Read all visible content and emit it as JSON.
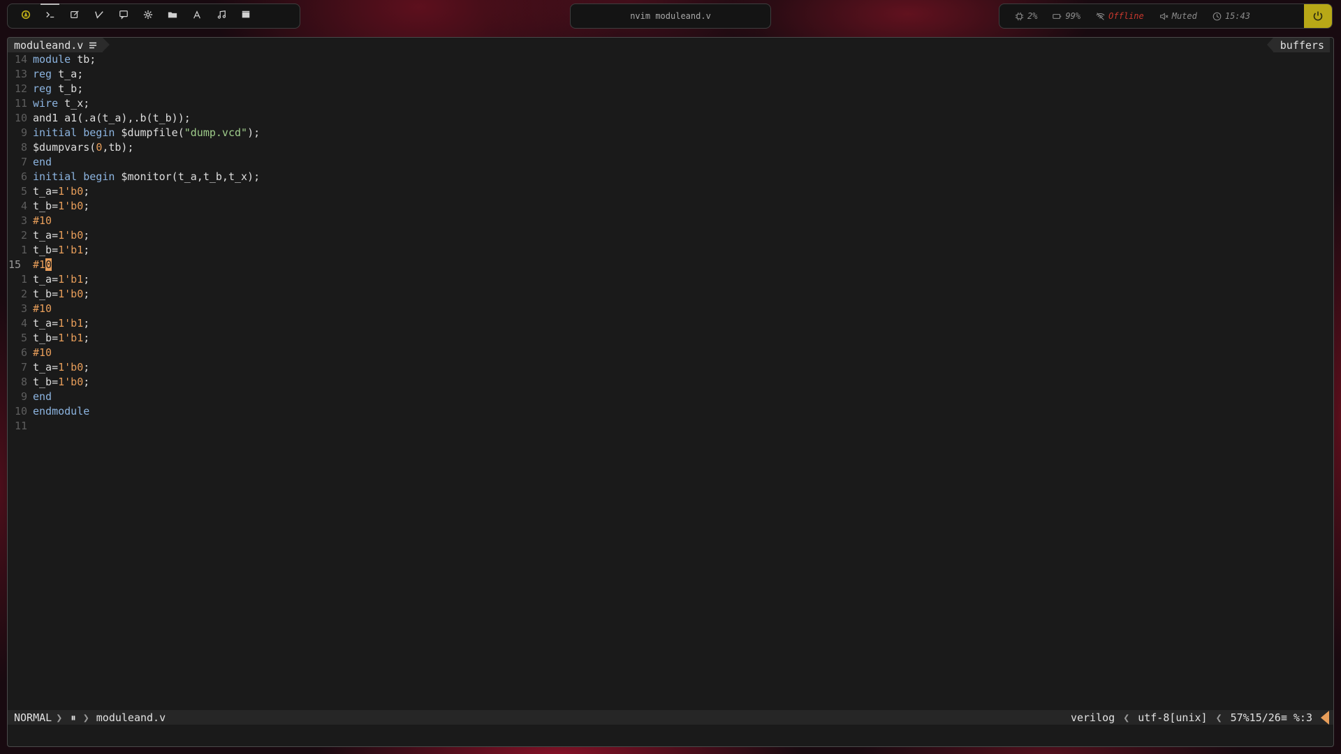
{
  "topbar": {
    "workspaces": [
      {
        "name": "arch-icon",
        "color": "#b8a817"
      },
      {
        "name": "terminal-icon",
        "color": "#d0d0d0"
      },
      {
        "name": "editor-icon",
        "color": "#d0d0d0"
      },
      {
        "name": "code-icon",
        "color": "#d0d0d0"
      },
      {
        "name": "chat-icon",
        "color": "#d0d0d0"
      },
      {
        "name": "settings-icon",
        "color": "#d0d0d0"
      },
      {
        "name": "folder-icon",
        "color": "#d0d0d0"
      },
      {
        "name": "font-icon",
        "color": "#d0d0d0"
      },
      {
        "name": "music-icon",
        "color": "#d0d0d0"
      },
      {
        "name": "video-icon",
        "color": "#d0d0d0"
      }
    ],
    "window_title": "nvim moduleand.v",
    "modules": {
      "cpu": "2%",
      "battery": "99%",
      "network": "Offline",
      "volume": "Muted",
      "clock": "15:43"
    },
    "power_color": "#b8a817"
  },
  "editor": {
    "tab_label": "moduleand.v",
    "buffers_label": "buffers",
    "lines": [
      {
        "n": "14",
        "parts": [
          [
            "kw",
            "module"
          ],
          [
            "txt",
            " tb;"
          ]
        ]
      },
      {
        "n": "13",
        "parts": [
          [
            "kw",
            "reg"
          ],
          [
            "txt",
            " t_a;"
          ]
        ]
      },
      {
        "n": "12",
        "parts": [
          [
            "kw",
            "reg"
          ],
          [
            "txt",
            " t_b;"
          ]
        ]
      },
      {
        "n": "11",
        "parts": [
          [
            "kw",
            "wire"
          ],
          [
            "txt",
            " t_x;"
          ]
        ]
      },
      {
        "n": "10",
        "parts": [
          [
            "txt",
            "and1 a1(.a(t_a),.b(t_b));"
          ]
        ]
      },
      {
        "n": "9",
        "parts": [
          [
            "kw",
            "initial"
          ],
          [
            "txt",
            " "
          ],
          [
            "kw",
            "begin"
          ],
          [
            "txt",
            " $dumpfile("
          ],
          [
            "str",
            "\"dump.vcd\""
          ],
          [
            "txt",
            ");"
          ]
        ]
      },
      {
        "n": "8",
        "parts": [
          [
            "txt",
            "$dumpvars("
          ],
          [
            "num",
            "0"
          ],
          [
            "txt",
            ",tb);"
          ]
        ]
      },
      {
        "n": "7",
        "parts": [
          [
            "kw",
            "end"
          ]
        ]
      },
      {
        "n": "6",
        "parts": [
          [
            "kw",
            "initial"
          ],
          [
            "txt",
            " "
          ],
          [
            "kw",
            "begin"
          ],
          [
            "txt",
            " $monitor(t_a,t_b,t_x);"
          ]
        ]
      },
      {
        "n": "5",
        "parts": [
          [
            "txt",
            "t_a="
          ],
          [
            "num",
            "1'b0"
          ],
          [
            "txt",
            ";"
          ]
        ]
      },
      {
        "n": "4",
        "parts": [
          [
            "txt",
            "t_b="
          ],
          [
            "num",
            "1'b0"
          ],
          [
            "txt",
            ";"
          ]
        ]
      },
      {
        "n": "3",
        "parts": [
          [
            "num",
            "#10"
          ]
        ]
      },
      {
        "n": "2",
        "parts": [
          [
            "txt",
            "t_a="
          ],
          [
            "num",
            "1'b0"
          ],
          [
            "txt",
            ";"
          ]
        ]
      },
      {
        "n": "1",
        "parts": [
          [
            "txt",
            "t_b="
          ],
          [
            "num",
            "1'b1"
          ],
          [
            "txt",
            ";"
          ]
        ]
      },
      {
        "n": "15",
        "current": true,
        "parts": [
          [
            "num",
            "#1"
          ],
          [
            "cursor",
            "0"
          ]
        ]
      },
      {
        "n": "1",
        "parts": [
          [
            "txt",
            "t_a="
          ],
          [
            "num",
            "1'b1"
          ],
          [
            "txt",
            ";"
          ]
        ]
      },
      {
        "n": "2",
        "parts": [
          [
            "txt",
            "t_b="
          ],
          [
            "num",
            "1'b0"
          ],
          [
            "txt",
            ";"
          ]
        ]
      },
      {
        "n": "3",
        "parts": [
          [
            "num",
            "#10"
          ]
        ]
      },
      {
        "n": "4",
        "parts": [
          [
            "txt",
            "t_a="
          ],
          [
            "num",
            "1'b1"
          ],
          [
            "txt",
            ";"
          ]
        ]
      },
      {
        "n": "5",
        "parts": [
          [
            "txt",
            "t_b="
          ],
          [
            "num",
            "1'b1"
          ],
          [
            "txt",
            ";"
          ]
        ]
      },
      {
        "n": "6",
        "parts": [
          [
            "num",
            "#10"
          ]
        ]
      },
      {
        "n": "7",
        "parts": [
          [
            "txt",
            "t_a="
          ],
          [
            "num",
            "1'b0"
          ],
          [
            "txt",
            ";"
          ]
        ]
      },
      {
        "n": "8",
        "parts": [
          [
            "txt",
            "t_b="
          ],
          [
            "num",
            "1'b0"
          ],
          [
            "txt",
            ";"
          ]
        ]
      },
      {
        "n": "9",
        "parts": [
          [
            "kw",
            "end"
          ]
        ]
      },
      {
        "n": "10",
        "parts": [
          [
            "kw",
            "endmodule"
          ]
        ]
      },
      {
        "n": "11",
        "parts": []
      }
    ]
  },
  "statusline": {
    "mode": "NORMAL",
    "paused_glyph": "⏸",
    "filename": "moduleand.v",
    "filetype": "verilog",
    "encoding": "utf-8[unix]",
    "position": "57%‍15/26≡ %:3"
  }
}
